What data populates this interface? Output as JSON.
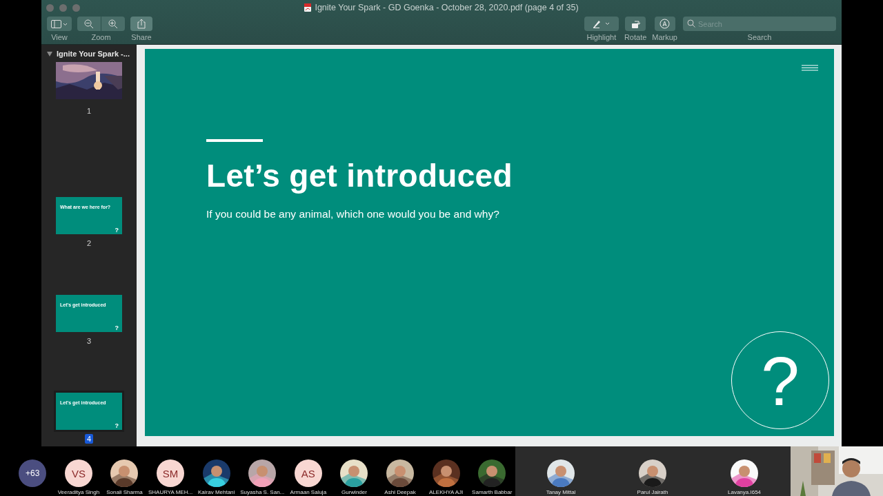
{
  "window": {
    "title": "Ignite Your Spark - GD Goenka - October 28, 2020.pdf (page 4 of 35)"
  },
  "toolbar": {
    "left": [
      {
        "kind": "view",
        "label": "View"
      },
      {
        "kind": "zoom",
        "label": "Zoom"
      },
      {
        "kind": "share",
        "label": "Share"
      }
    ],
    "right": [
      {
        "kind": "highlight",
        "label": "Highlight"
      },
      {
        "kind": "rotate",
        "label": "Rotate"
      },
      {
        "kind": "markup",
        "label": "Markup"
      }
    ],
    "search": {
      "placeholder": "Search",
      "label": "Search"
    }
  },
  "sidebar": {
    "title": "Ignite Your Spark -...",
    "expanded": true,
    "pages": [
      {
        "number": "1",
        "kind": "picture",
        "selected": false
      },
      {
        "number": "2",
        "kind": "slide",
        "title": "What are we here for?",
        "selected": false
      },
      {
        "number": "3",
        "kind": "slide",
        "title": "Let's get introduced",
        "selected": false
      },
      {
        "number": "4",
        "kind": "slide",
        "title": "Let's get introduced",
        "selected": true
      }
    ]
  },
  "slide": {
    "title": "Let’s get introduced",
    "subtitle": "If you could be any animal, which one would you be and why?",
    "mark": "?"
  },
  "participants": [
    {
      "kind": "count",
      "label": "+63"
    },
    {
      "kind": "initials",
      "initials": "VS",
      "name": "Veeraditya Singh",
      "wide": false
    },
    {
      "name": "Sonali Sharma",
      "wide": false
    },
    {
      "kind": "initials",
      "initials": "SM",
      "name": "SHAURYA MEH...",
      "wide": false
    },
    {
      "name": "Kairav Mehtani",
      "wide": false
    },
    {
      "name": "Suyasha S. San...",
      "wide": false
    },
    {
      "kind": "initials",
      "initials": "AS",
      "name": "Armaan Saluja",
      "wide": false
    },
    {
      "name": "Gurwinder",
      "wide": false
    },
    {
      "name": "Ashi Deepak",
      "wide": false
    },
    {
      "name": "ALEKHYA AJI",
      "wide": false
    },
    {
      "name": "Samarth Babbar",
      "wide": false
    },
    {
      "name": "Tanay Mittal",
      "wide": true
    },
    {
      "name": "Parul Jairath",
      "wide": true
    },
    {
      "name": "Lavanya.I654",
      "wide": true
    },
    {
      "kind": "video"
    }
  ]
}
